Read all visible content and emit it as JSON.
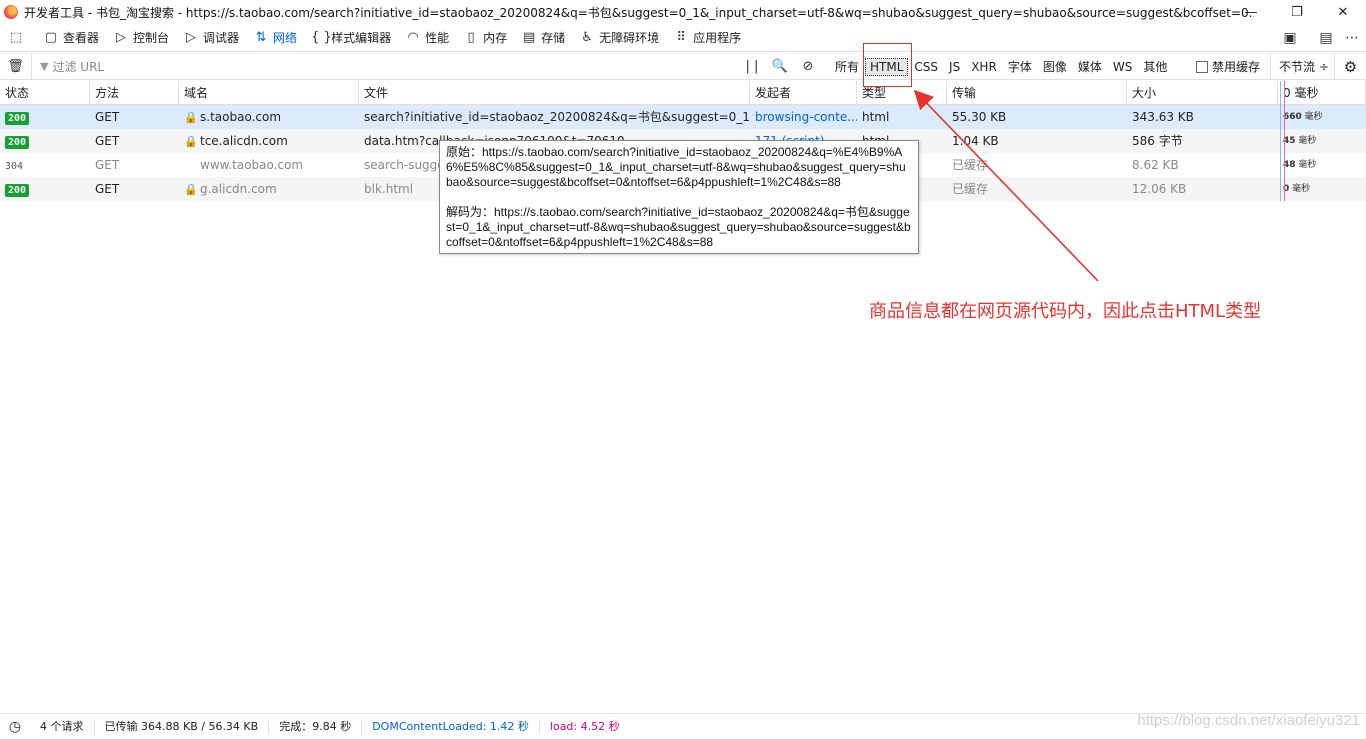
{
  "window": {
    "title": "开发者工具 - 书包_淘宝搜索 - https://s.taobao.com/search?initiative_id=staobaoz_20200824&q=书包&suggest=0_1&_input_charset=utf-8&wq=shubao&suggest_query=shubao&source=suggest&bcoffset=0...",
    "minimize": "—",
    "restore": "❐",
    "close": "✕"
  },
  "toolbar": {
    "tabs": [
      {
        "label": "查看器",
        "icon": "inspector-icon",
        "glyph": "▢"
      },
      {
        "label": "控制台",
        "icon": "console-icon",
        "glyph": "▷"
      },
      {
        "label": "调试器",
        "icon": "debugger-icon",
        "glyph": "▷"
      },
      {
        "label": "网络",
        "icon": "network-icon",
        "glyph": "⇅"
      },
      {
        "label": "样式编辑器",
        "icon": "style-editor-icon",
        "glyph": "{ }"
      },
      {
        "label": "性能",
        "icon": "performance-icon",
        "glyph": "◠"
      },
      {
        "label": "内存",
        "icon": "memory-icon",
        "glyph": "▯"
      },
      {
        "label": "存储",
        "icon": "storage-icon",
        "glyph": "▤"
      },
      {
        "label": "无障碍环境",
        "icon": "accessibility-icon",
        "glyph": "♿"
      },
      {
        "label": "应用程序",
        "icon": "application-icon",
        "glyph": "⠿"
      }
    ],
    "active_tab": "网络"
  },
  "filterbar": {
    "filter_placeholder": "过滤 URL",
    "types": [
      "所有",
      "HTML",
      "CSS",
      "JS",
      "XHR",
      "字体",
      "图像",
      "媒体",
      "WS",
      "其他"
    ],
    "selected_type": "HTML",
    "disable_cache": "禁用缓存",
    "throttle": "不节流 ÷"
  },
  "table": {
    "headers": [
      "状态",
      "方法",
      "域名",
      "文件",
      "发起者",
      "类型",
      "传输",
      "大小",
      "0 毫秒"
    ],
    "rows": [
      {
        "status": "200",
        "method": "GET",
        "domain": "s.taobao.com",
        "file": "search?initiative_id=staobaoz_20200824&q=书包&suggest=0_1&_inp...",
        "initiator": "browsing-conte...",
        "type": "html",
        "transferred": "55.30 KB",
        "size": "343.63 KB",
        "timing_ms": "660",
        "timing_unit": "毫秒",
        "secure": true,
        "status_style": "badge"
      },
      {
        "status": "200",
        "method": "GET",
        "domain": "tce.alicdn.com",
        "file": "data.htm?callback=jsonp706100&t=70610",
        "initiator": "171 (script)",
        "type": "html",
        "transferred": "1.04 KB",
        "size": "586 字节",
        "timing_ms": "45",
        "timing_unit": "毫秒",
        "secure": true,
        "status_style": "badge"
      },
      {
        "status": "304",
        "method": "GET",
        "domain": "www.taobao.com",
        "file": "search-sugges",
        "initiator": "",
        "type": "",
        "transferred": "已缓存",
        "size": "8.62 KB",
        "timing_ms": "48",
        "timing_unit": "毫秒",
        "secure": false,
        "status_style": "plain"
      },
      {
        "status": "200",
        "method": "GET",
        "domain": "g.alicdn.com",
        "file": "blk.html",
        "initiator": "",
        "type": "",
        "transferred": "已缓存",
        "size": "12.06 KB",
        "timing_ms": "0",
        "timing_unit": "毫秒",
        "secure": true,
        "status_style": "badge"
      }
    ]
  },
  "tooltip": {
    "original": "原始：https://s.taobao.com/search?initiative_id=staobaoz_20200824&q=%E4%B9%A6%E5%8C%85&suggest=0_1&_input_charset=utf-8&wq=shubao&suggest_query=shubao&source=suggest&bcoffset=0&ntoffset=6&p4ppushleft=1%2C48&s=88",
    "decoded": "解码为：https://s.taobao.com/search?initiative_id=staobaoz_20200824&q=书包&suggest=0_1&_input_charset=utf-8&wq=shubao&suggest_query=shubao&source=suggest&bcoffset=0&ntoffset=6&p4ppushleft=1%2C48&s=88"
  },
  "annotation": {
    "text": "商品信息都在网页源代码内，因此点击HTML类型",
    "color": "#e8322e"
  },
  "statusbar": {
    "requests": "4 个请求",
    "transferred": "已传输 364.88 KB / 56.34 KB",
    "finish": "完成：9.84 秒",
    "dcl": "DOMContentLoaded: 1.42 秒",
    "load": "load: 4.52 秒"
  },
  "watermark": "https://blog.csdn.net/xiaofeiyu321"
}
